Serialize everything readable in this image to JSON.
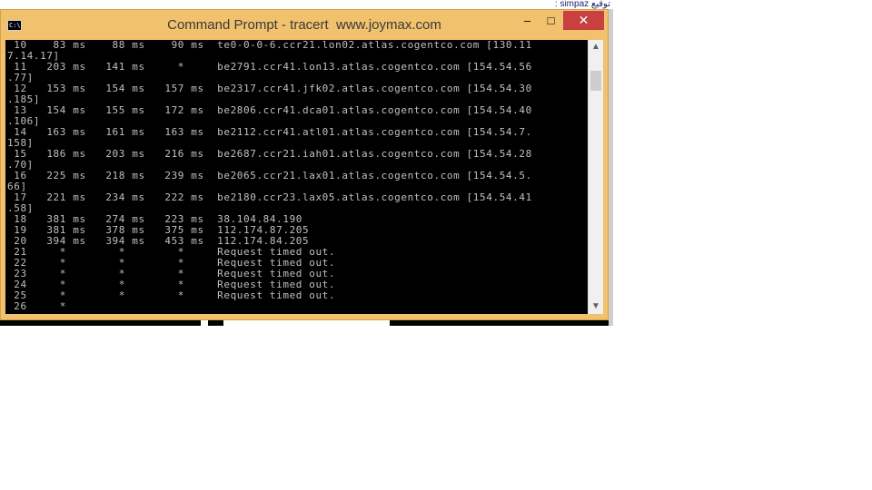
{
  "top_note": "توقيع simpaz :",
  "window": {
    "title": "Command Prompt - tracert  www.joymax.com",
    "icon_label": "C:\\.",
    "minimize_glyph": "–",
    "maximize_glyph": "□",
    "close_glyph": "✕"
  },
  "scrollbar": {
    "up_glyph": "▲",
    "down_glyph": "▼"
  },
  "console": {
    "lines": [
      " 10    83 ms    88 ms    90 ms  te0-0-0-6.ccr21.lon02.atlas.cogentco.com [130.11",
      "7.14.17]",
      " 11   203 ms   141 ms     *     be2791.ccr41.lon13.atlas.cogentco.com [154.54.56",
      ".77]",
      " 12   153 ms   154 ms   157 ms  be2317.ccr41.jfk02.atlas.cogentco.com [154.54.30",
      ".185]",
      " 13   154 ms   155 ms   172 ms  be2806.ccr41.dca01.atlas.cogentco.com [154.54.40",
      ".106]",
      " 14   163 ms   161 ms   163 ms  be2112.ccr41.atl01.atlas.cogentco.com [154.54.7.",
      "158]",
      " 15   186 ms   203 ms   216 ms  be2687.ccr21.iah01.atlas.cogentco.com [154.54.28",
      ".70]",
      " 16   225 ms   218 ms   239 ms  be2065.ccr21.lax01.atlas.cogentco.com [154.54.5.",
      "66]",
      " 17   221 ms   234 ms   222 ms  be2180.ccr23.lax05.atlas.cogentco.com [154.54.41",
      ".58]",
      " 18   381 ms   274 ms   223 ms  38.104.84.190",
      " 19   381 ms   378 ms   375 ms  112.174.87.205",
      " 20   394 ms   394 ms   453 ms  112.174.84.205",
      " 21     *        *        *     Request timed out.",
      " 22     *        *        *     Request timed out.",
      " 23     *        *        *     Request timed out.",
      " 24     *        *        *     Request timed out.",
      " 25     *        *        *     Request timed out.",
      " 26     *"
    ]
  }
}
